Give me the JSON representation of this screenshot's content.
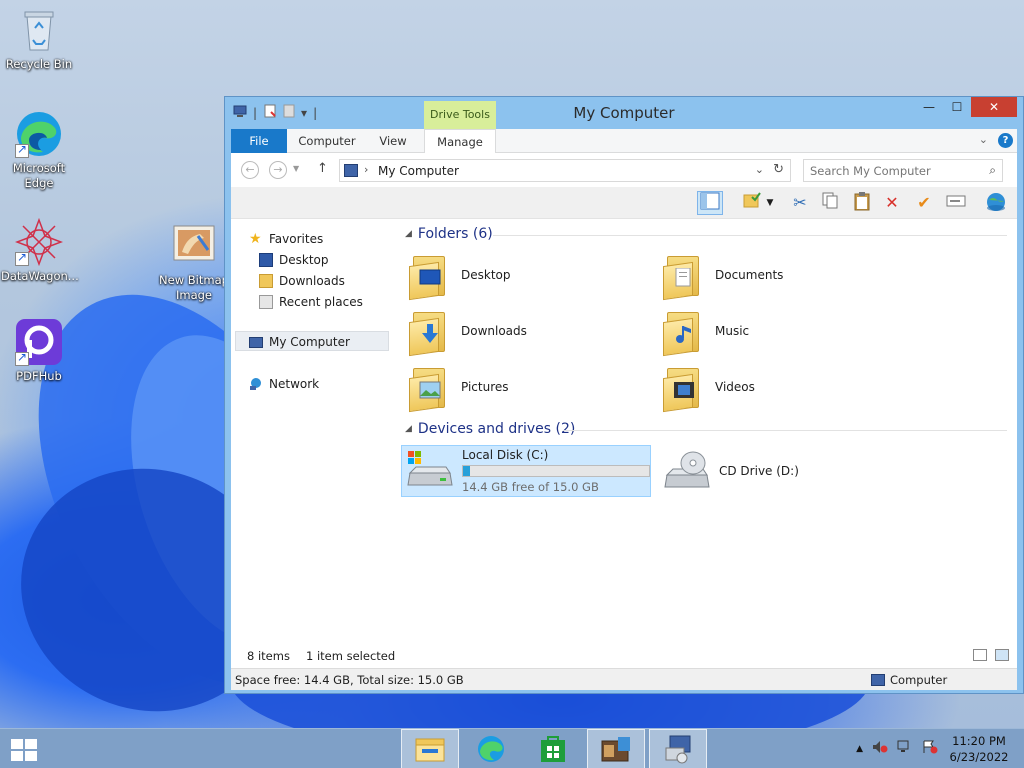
{
  "desktop": {
    "icons": [
      {
        "label": "Recycle Bin"
      },
      {
        "label": "Microsoft Edge"
      },
      {
        "label": "DataWagon..."
      },
      {
        "label": "PDFHub"
      },
      {
        "label": "New Bitmap Image"
      }
    ]
  },
  "window": {
    "title": "My Computer",
    "context_tab_group": "Drive Tools",
    "tabs": {
      "file": "File",
      "computer": "Computer",
      "view": "View",
      "manage": "Manage"
    },
    "address": {
      "path": "My Computer",
      "separator": "›"
    },
    "search": {
      "placeholder": "Search My Computer"
    },
    "nav_pane": {
      "favorites": "Favorites",
      "favorites_items": [
        "Desktop",
        "Downloads",
        "Recent places"
      ],
      "my_computer": "My Computer",
      "network": "Network"
    },
    "folders_group": {
      "title": "Folders (6)",
      "items": [
        {
          "name": "Desktop",
          "icon": "desktop-folder-icon"
        },
        {
          "name": "Documents",
          "icon": "documents-folder-icon"
        },
        {
          "name": "Downloads",
          "icon": "downloads-folder-icon"
        },
        {
          "name": "Music",
          "icon": "music-folder-icon"
        },
        {
          "name": "Pictures",
          "icon": "pictures-folder-icon"
        },
        {
          "name": "Videos",
          "icon": "videos-folder-icon"
        }
      ]
    },
    "drives_group": {
      "title": "Devices and drives (2)",
      "drives": [
        {
          "name": "Local Disk (C:)",
          "free_text": "14.4 GB free of 15.0 GB",
          "used_fraction": 0.04,
          "selected": true
        },
        {
          "name": "CD Drive (D:)"
        }
      ]
    },
    "status": {
      "item_count": "8 items",
      "selection": "1 item selected"
    },
    "details": {
      "space": "Space free: 14.4 GB, Total size: 15.0 GB",
      "location": "Computer"
    }
  },
  "taskbar": {
    "clock_time": "11:20 PM",
    "clock_date": "6/23/2022"
  },
  "colors": {
    "accent": "#1979ca",
    "selection": "#cce8ff",
    "close": "#c84031",
    "drive_tools": "#d8ee9a",
    "progress": "#26a0da"
  }
}
